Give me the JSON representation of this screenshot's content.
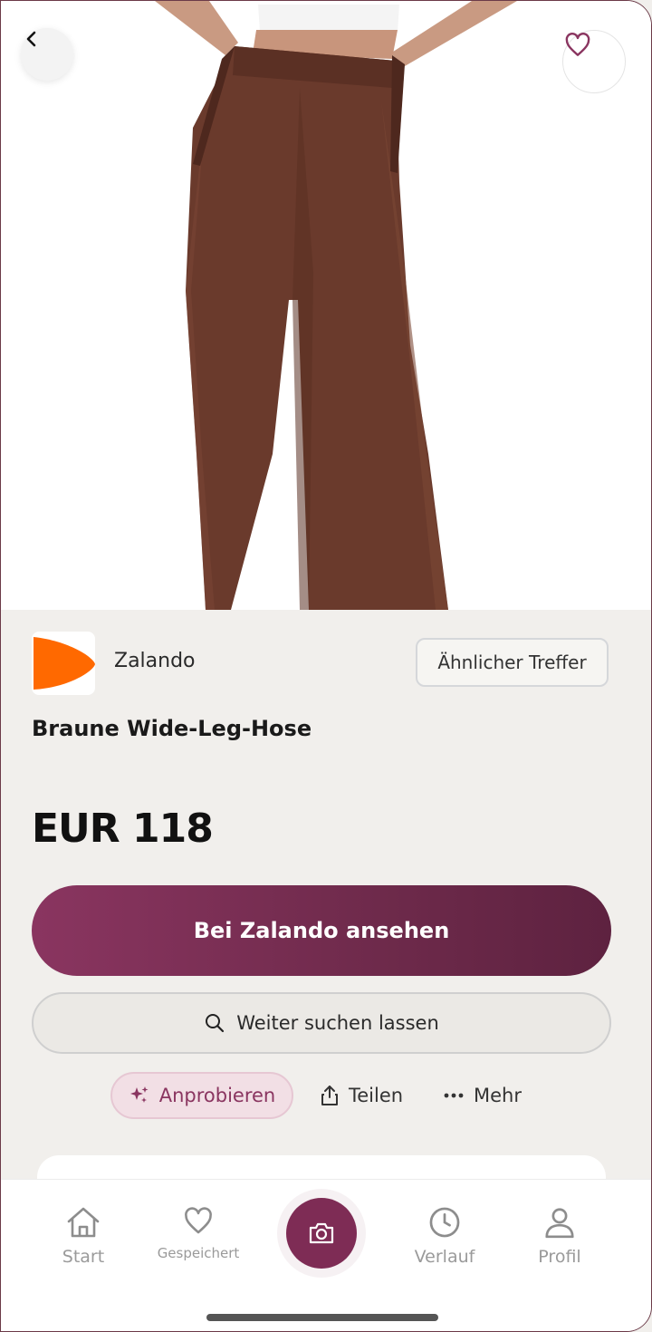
{
  "product": {
    "shop_name": "Zalando",
    "similar_label": "Ähnlicher Treffer",
    "title": "Braune Wide-Leg-Hose",
    "price": "EUR 118"
  },
  "actions": {
    "primary": "Bei Zalando ansehen",
    "secondary": "Weiter suchen lassen",
    "try_on": "Anprobieren",
    "share": "Teilen",
    "more": "Mehr"
  },
  "nav": {
    "start": "Start",
    "saved": "Gespeichert",
    "history": "Verlauf",
    "profile": "Profil"
  },
  "colors": {
    "accent": "#7e2c55",
    "brand_logo": "#ff6900",
    "product": "#6a3a2c"
  },
  "icons": {
    "back": "chevron-left-icon",
    "favorite": "heart-icon",
    "search": "search-icon",
    "sparkle": "sparkle-icon",
    "share": "share-icon",
    "more": "dots-icon",
    "home": "home-icon",
    "saved": "heart-icon",
    "camera": "camera-icon",
    "history": "clock-icon",
    "profile": "user-icon"
  }
}
